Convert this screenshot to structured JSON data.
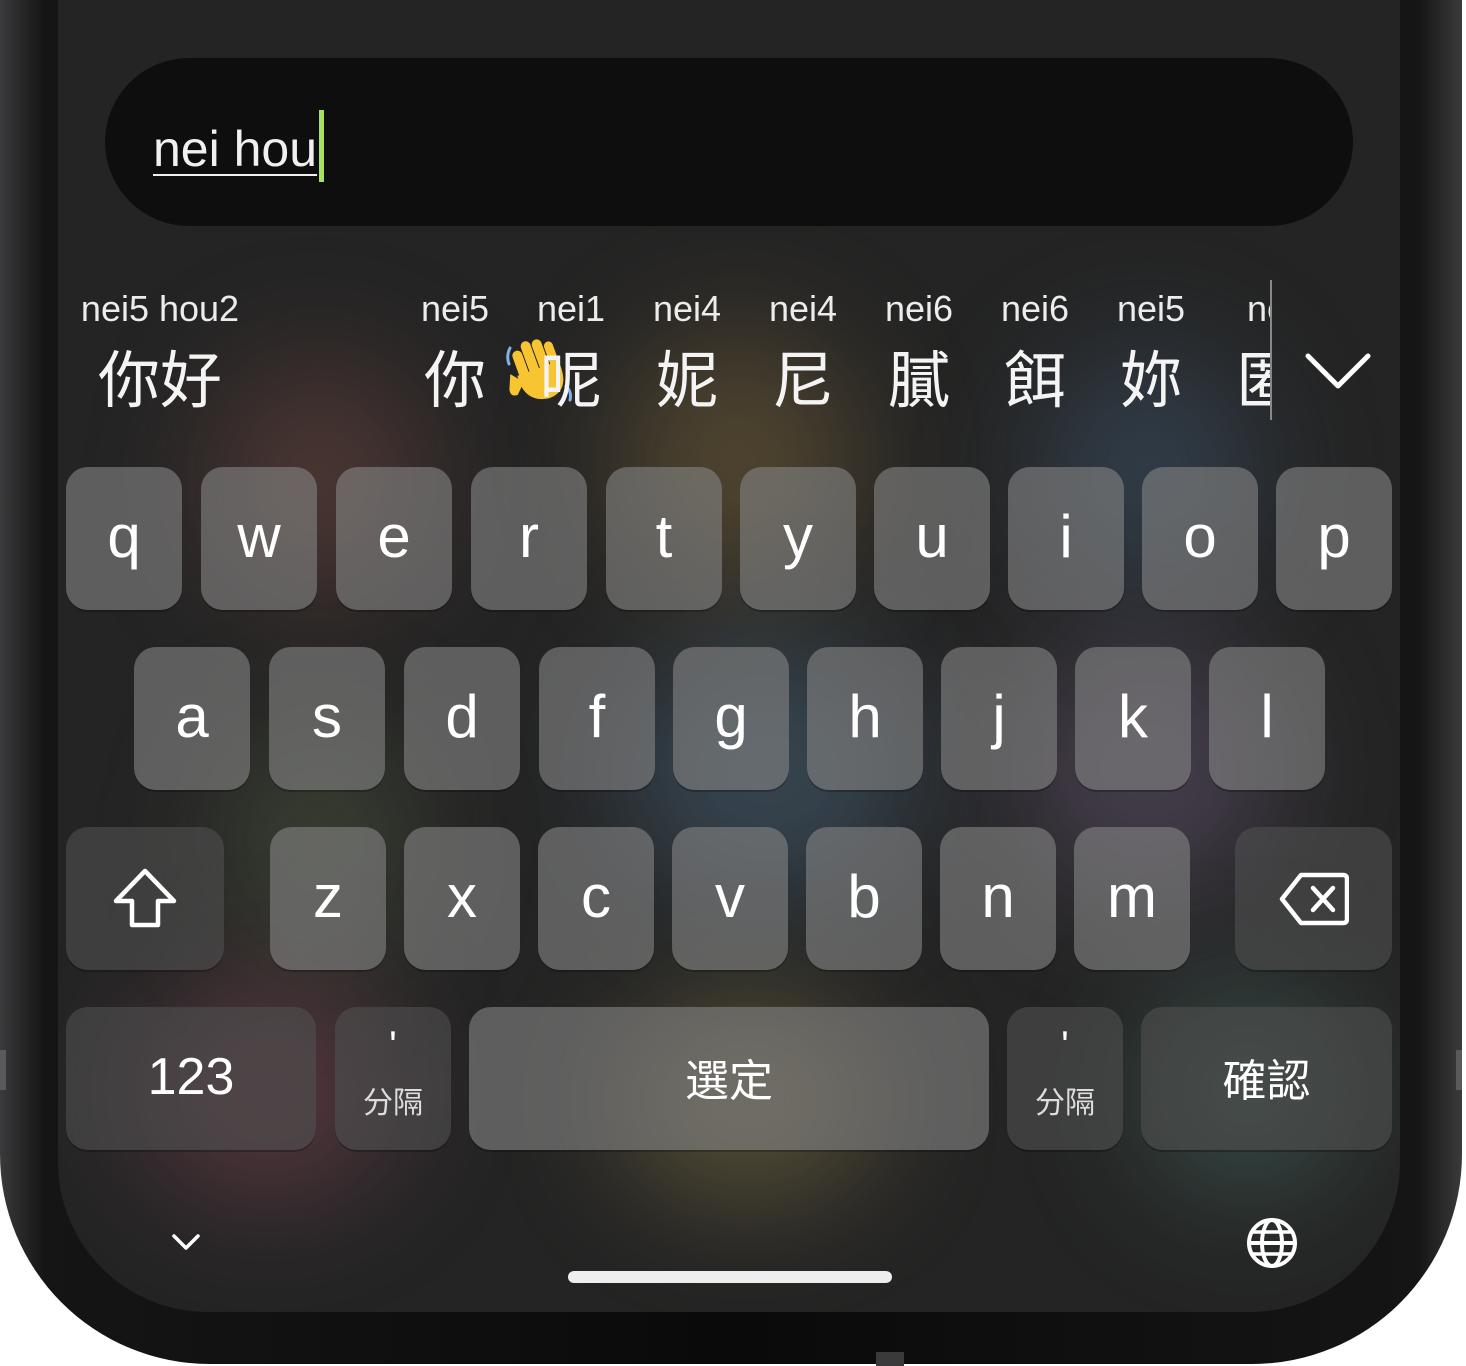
{
  "input": {
    "text": "nei hou"
  },
  "candidates": [
    {
      "roman": "nei5 hou2",
      "hanzi": "你好"
    },
    {
      "roman": "",
      "hanzi": "",
      "icon": "waving-hand-emoji"
    },
    {
      "roman": "nei5",
      "hanzi": "你"
    },
    {
      "roman": "nei1",
      "hanzi": "呢"
    },
    {
      "roman": "nei4",
      "hanzi": "妮"
    },
    {
      "roman": "nei4",
      "hanzi": "尼"
    },
    {
      "roman": "nei6",
      "hanzi": "膩"
    },
    {
      "roman": "nei6",
      "hanzi": "餌"
    },
    {
      "roman": "nei5",
      "hanzi": "妳"
    },
    {
      "roman": "ne",
      "hanzi": "匿"
    }
  ],
  "keys": {
    "row1": [
      "q",
      "w",
      "e",
      "r",
      "t",
      "y",
      "u",
      "i",
      "o",
      "p"
    ],
    "row2": [
      "a",
      "s",
      "d",
      "f",
      "g",
      "h",
      "j",
      "k",
      "l"
    ],
    "row3": [
      "z",
      "x",
      "c",
      "v",
      "b",
      "n",
      "m"
    ]
  },
  "bottom_row": {
    "numbers_label": "123",
    "separator_symbol": "'",
    "separator_label": "分隔",
    "space_label": "選定",
    "confirm_label": "確認"
  },
  "icons": {
    "shift": "shift-arrow-icon",
    "backspace": "backspace-icon",
    "expand": "chevron-down-icon",
    "dismiss": "chevron-down-icon",
    "language": "globe-icon"
  }
}
